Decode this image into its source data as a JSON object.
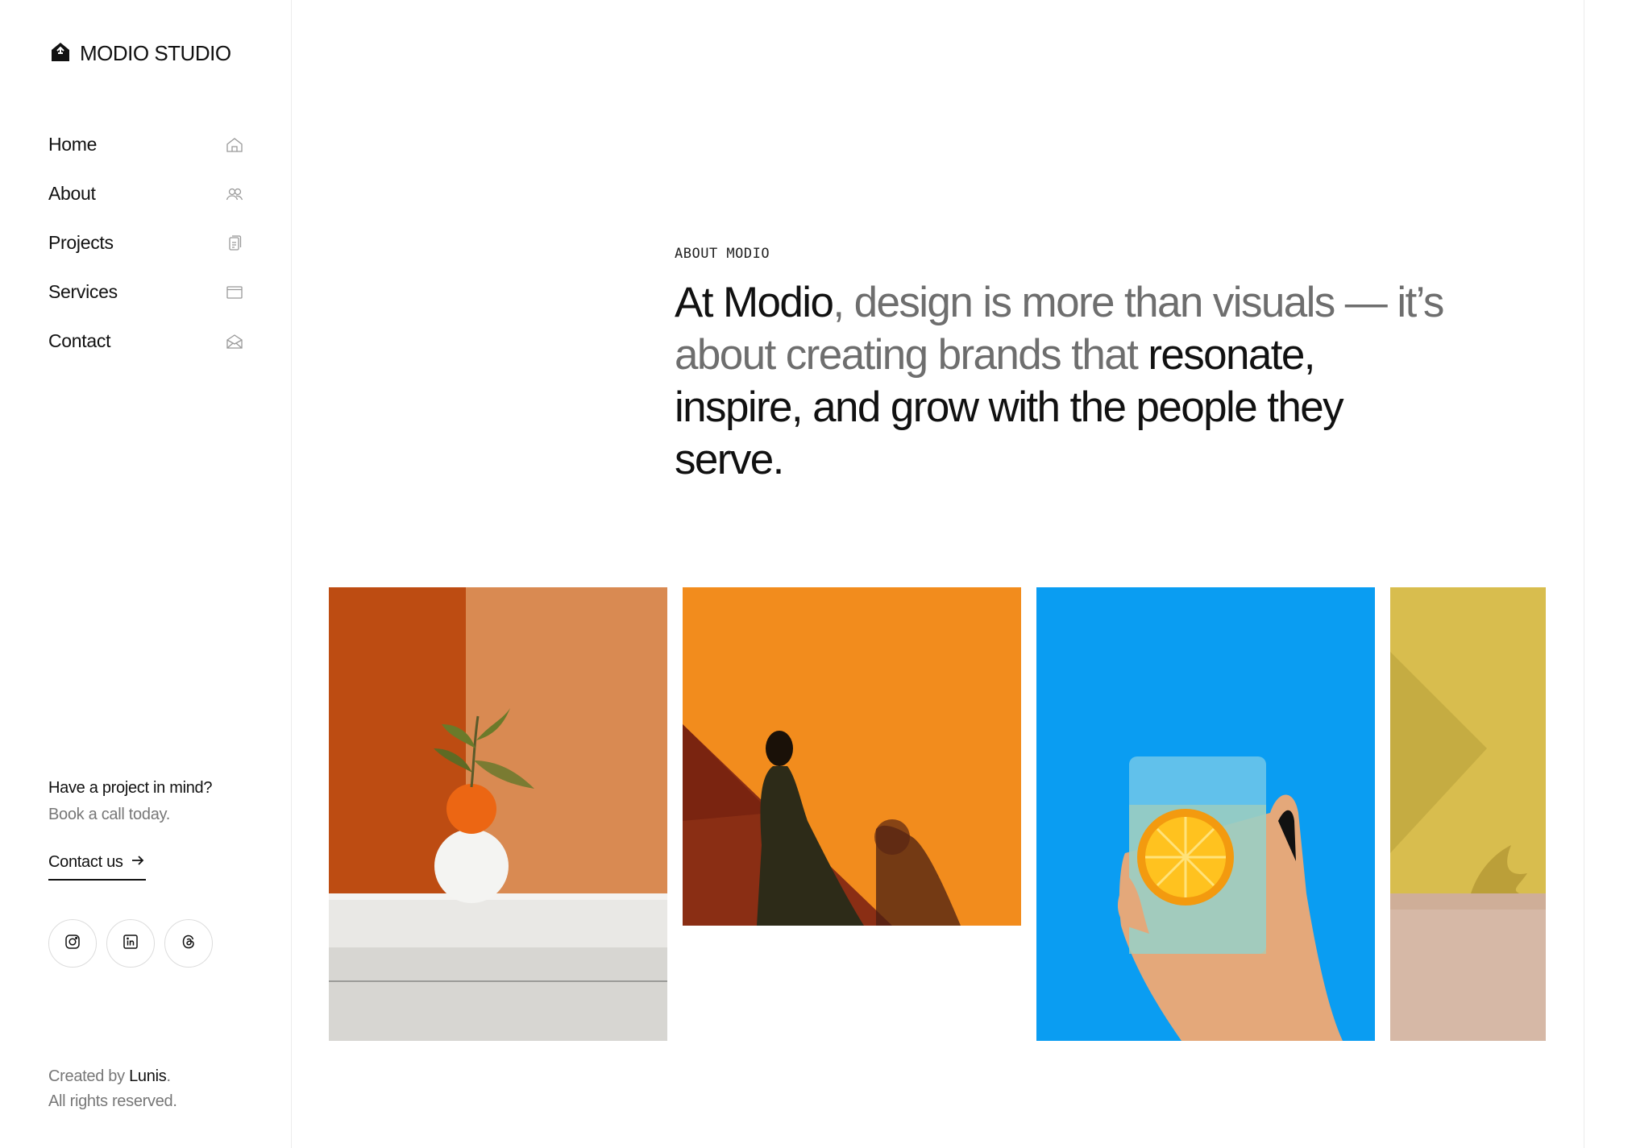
{
  "brand": {
    "name": "MODIO STUDIO",
    "logo": "house-logo-icon"
  },
  "nav": {
    "items": [
      {
        "label": "Home",
        "icon": "home-icon"
      },
      {
        "label": "About",
        "icon": "users-icon"
      },
      {
        "label": "Projects",
        "icon": "files-icon"
      },
      {
        "label": "Services",
        "icon": "browser-window-icon"
      },
      {
        "label": "Contact",
        "icon": "envelope-open-icon"
      }
    ]
  },
  "cta": {
    "title": "Have a project in mind?",
    "subtitle": "Book a call today.",
    "link_label": "Contact us"
  },
  "socials": [
    {
      "icon": "instagram-icon"
    },
    {
      "icon": "linkedin-icon"
    },
    {
      "icon": "threads-icon"
    }
  ],
  "footer": {
    "created_by_prefix": "Created by",
    "author": "Lunis",
    "suffix": ".",
    "rights": "All rights reserved."
  },
  "about": {
    "eyebrow": "ABOUT MODIO",
    "headline": {
      "part1": "At Modio",
      "part2": ", design is more than visuals — it’s about creating brands that ",
      "part3": "resonate, inspire, and grow with the people they serve."
    }
  },
  "gallery": [
    {
      "subject": "orange-on-white-vase-photo"
    },
    {
      "subject": "person-silhouette-orange-wall-photo"
    },
    {
      "subject": "hand-glass-orange-slice-photo"
    },
    {
      "subject": "yellow-wall-plant-shadow-photo"
    }
  ],
  "colors": {
    "text_primary": "#111111",
    "text_muted": "#6e6e6e",
    "border": "#ececec",
    "accent_orange": "#f28a1c",
    "accent_blue": "#0a9df2",
    "accent_yellow": "#d8bd4e"
  }
}
